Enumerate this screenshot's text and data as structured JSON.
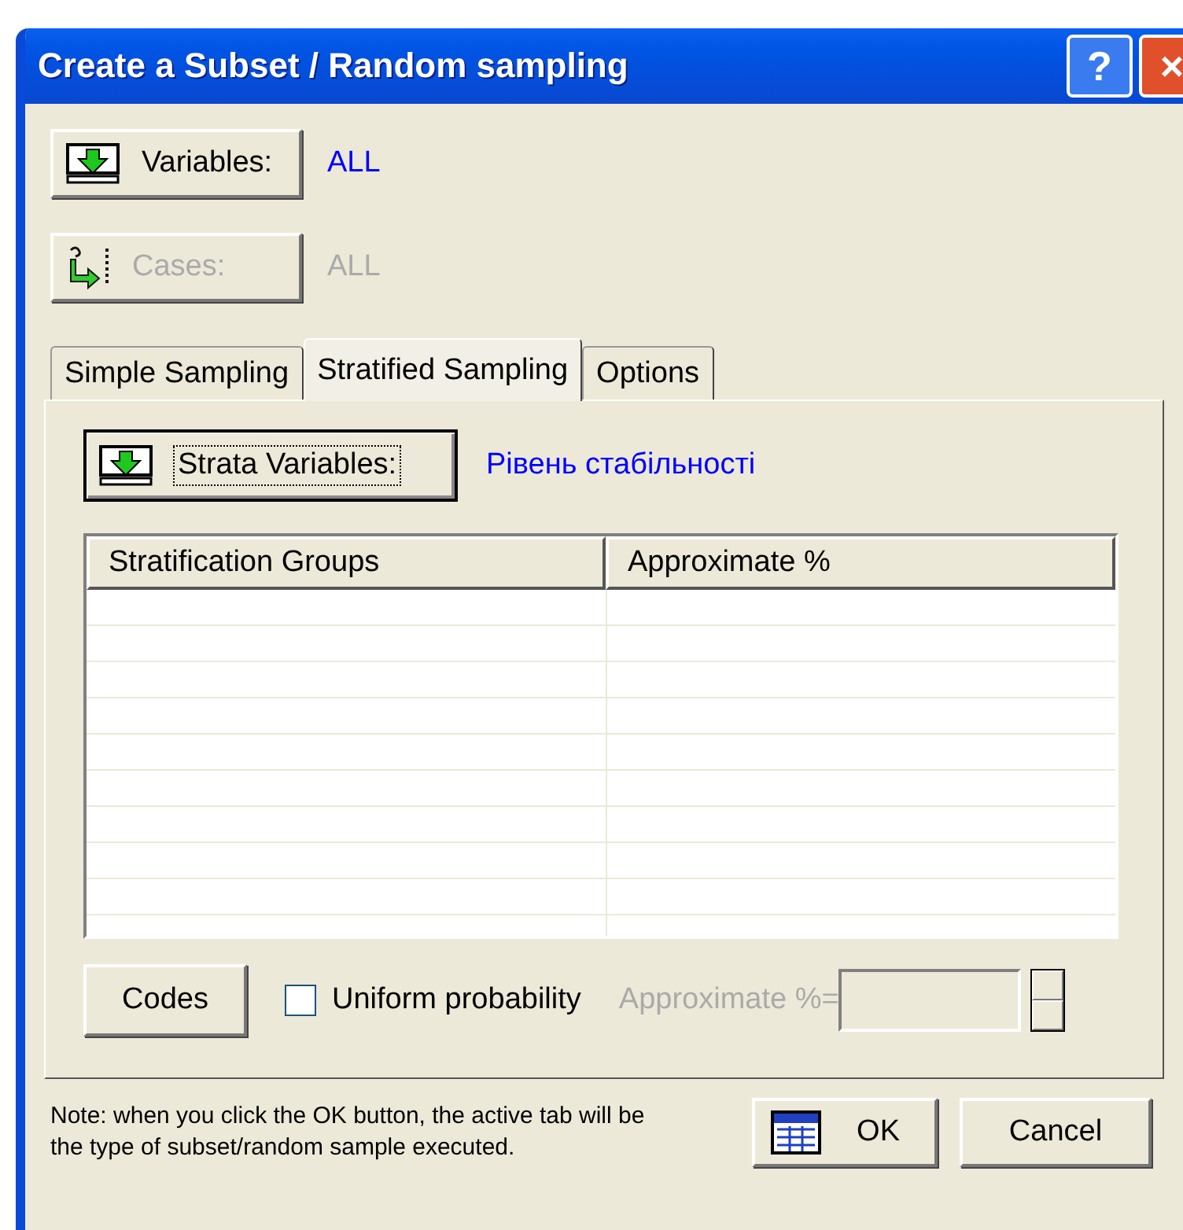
{
  "window": {
    "title": "Create a Subset / Random sampling",
    "help_button": "?",
    "close_button": "×"
  },
  "selectors": [
    {
      "label": "Variables:",
      "value": "ALL",
      "disabled": false,
      "kind": "variables"
    },
    {
      "label": "Cases:",
      "value": "ALL",
      "disabled": true,
      "kind": "cases"
    }
  ],
  "tabs": [
    {
      "label": "Simple Sampling",
      "selected": false
    },
    {
      "label": "Stratified Sampling",
      "selected": true
    },
    {
      "label": "Options",
      "selected": false
    }
  ],
  "strata": {
    "label": "Strata Variables:",
    "value": "Рівень стабільності"
  },
  "table": {
    "columns": [
      "Stratification Groups",
      "Approximate %"
    ]
  },
  "codes_button": "Codes",
  "uniform": {
    "label": "Uniform probability",
    "checked": false
  },
  "approximate": {
    "label": "Approximate %=",
    "disabled": true
  },
  "note": "Note: when you click the OK button, the active tab will be the type of subset/random sample executed.",
  "buttons": [
    {
      "label": "OK",
      "kind": "ok"
    },
    {
      "label": "Cancel",
      "kind": "cancel"
    }
  ]
}
